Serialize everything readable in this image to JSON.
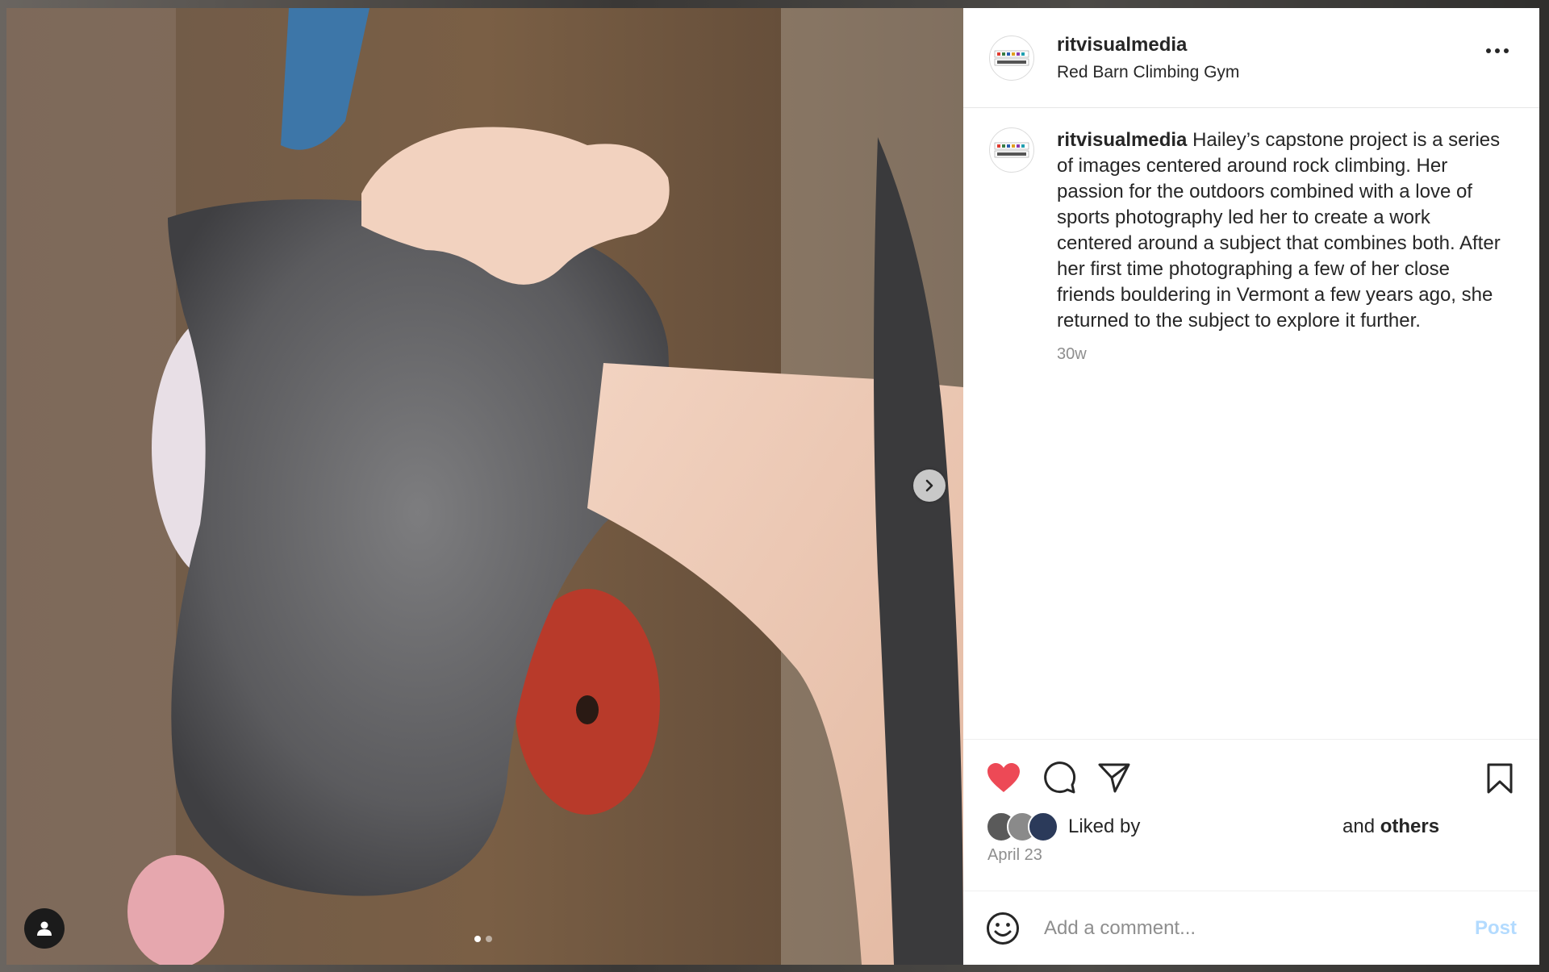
{
  "post": {
    "username": "ritvisualmedia",
    "location": "Red Barn Climbing Gym",
    "avatar_text": "VISUAL MEDIA",
    "caption_user": "ritvisualmedia",
    "caption_text": " Hailey’s capstone project is a series of images centered around rock climbing. Her passion for the outdoors combined with a love of sports photography led her to create a work centered around a subject that combines both. After her first time photographing a few of her close friends bouldering in Vermont a few years ago, she returned to the subject to explore it further.",
    "time_ago": "30w"
  },
  "media": {
    "carousel_count": 2,
    "carousel_active_index": 0,
    "icons": [
      "chevron-right-icon",
      "user-tag-icon"
    ]
  },
  "actions": {
    "liked": true,
    "icons": [
      "heart-icon",
      "comment-icon",
      "share-icon",
      "bookmark-icon"
    ],
    "liked_by_label": "Liked by",
    "and_label": "and ",
    "others_label": "others",
    "date": "April 23"
  },
  "comment_box": {
    "placeholder": "Add a comment...",
    "post_label": "Post",
    "icon": "emoji-icon"
  },
  "colors": {
    "heart": "#ed4956",
    "post_disabled": "#b3dbff",
    "secondary_text": "#8e8e8e"
  }
}
